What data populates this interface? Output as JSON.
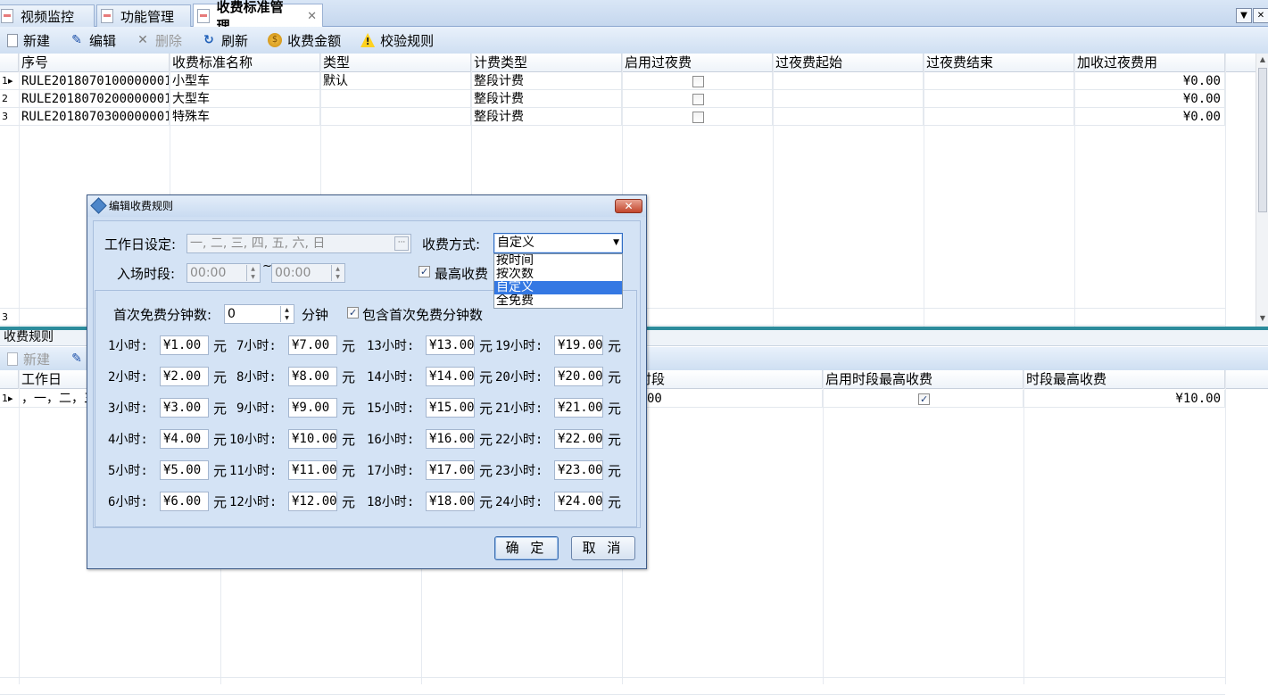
{
  "tabs": [
    {
      "label": "视频监控",
      "active": false
    },
    {
      "label": "功能管理",
      "active": false
    },
    {
      "label": "收费标准管理",
      "active": true
    }
  ],
  "tab_close_glyph": "✕",
  "toolbar1": {
    "new": "新建",
    "edit": "编辑",
    "delete": "删除",
    "refresh": "刷新",
    "fee_amount": "收费金额",
    "validate_rule": "校验规则"
  },
  "grid1": {
    "columns": [
      "序号",
      "收费标准名称",
      "类型",
      "计费类型",
      "启用过夜费",
      "过夜费起始",
      "过夜费结束",
      "加收过夜费用"
    ],
    "rows": [
      {
        "no": "1",
        "id": "RULE2018070100000001",
        "name": "小型车",
        "type": "默认",
        "bill_type": "整段计费",
        "overnight": false,
        "start": "",
        "end": "",
        "fee": "¥0.00"
      },
      {
        "no": "2",
        "id": "RULE2018070200000001",
        "name": "大型车",
        "type": "",
        "bill_type": "整段计费",
        "overnight": false,
        "start": "",
        "end": "",
        "fee": "¥0.00"
      },
      {
        "no": "3",
        "id": "RULE2018070300000001",
        "name": "特殊车",
        "type": "",
        "bill_type": "整段计费",
        "overnight": false,
        "start": "",
        "end": "",
        "fee": "¥0.00"
      }
    ],
    "footer_count": "3"
  },
  "section2": {
    "title": "收费规则",
    "toolbar_new": "新建",
    "columns": [
      "工作日",
      "时段",
      "启用时段最高收费",
      "时段最高收费"
    ],
    "column_partial_visible": "段",
    "row": {
      "no": "1",
      "weekdays": "，一，二，三，",
      "period_tail": "00",
      "max_enabled": true,
      "max_fee": "¥10.00"
    }
  },
  "dialog": {
    "title": "编辑收费规则",
    "close_glyph": "✕",
    "workday_label": "工作日设定:",
    "workday_value": "一, 二, 三, 四, 五, 六, 日",
    "ellipsis": "···",
    "fee_mode_label": "收费方式:",
    "fee_mode_value": "自定义",
    "fee_mode_options": [
      "按时间",
      "按次数",
      "自定义",
      "全免费"
    ],
    "selected_option_index": 2,
    "entry_period_label": "入场时段:",
    "entry_start": "00:00",
    "entry_end": "00:00",
    "tilde": "~",
    "max_fee_label": "最高收费",
    "max_fee_checked": true,
    "free_minutes_label": "首次免费分钟数:",
    "free_minutes_value": "0",
    "minutes_unit": "分钟",
    "include_free_label": "包含首次免费分钟数",
    "include_free_checked": true,
    "hourly_fees": [
      {
        "label": "1小时:",
        "value": "¥1.00"
      },
      {
        "label": "2小时:",
        "value": "¥2.00"
      },
      {
        "label": "3小时:",
        "value": "¥3.00"
      },
      {
        "label": "4小时:",
        "value": "¥4.00"
      },
      {
        "label": "5小时:",
        "value": "¥5.00"
      },
      {
        "label": "6小时:",
        "value": "¥6.00"
      },
      {
        "label": "7小时:",
        "value": "¥7.00"
      },
      {
        "label": "8小时:",
        "value": "¥8.00"
      },
      {
        "label": "9小时:",
        "value": "¥9.00"
      },
      {
        "label": "10小时:",
        "value": "¥10.00"
      },
      {
        "label": "11小时:",
        "value": "¥11.00"
      },
      {
        "label": "12小时:",
        "value": "¥12.00"
      },
      {
        "label": "13小时:",
        "value": "¥13.00"
      },
      {
        "label": "14小时:",
        "value": "¥14.00"
      },
      {
        "label": "15小时:",
        "value": "¥15.00"
      },
      {
        "label": "16小时:",
        "value": "¥16.00"
      },
      {
        "label": "17小时:",
        "value": "¥17.00"
      },
      {
        "label": "18小时:",
        "value": "¥18.00"
      },
      {
        "label": "19小时:",
        "value": "¥19.00"
      },
      {
        "label": "20小时:",
        "value": "¥20.00"
      },
      {
        "label": "21小时:",
        "value": "¥21.00"
      },
      {
        "label": "22小时:",
        "value": "¥22.00"
      },
      {
        "label": "23小时:",
        "value": "¥23.00"
      },
      {
        "label": "24小时:",
        "value": "¥24.00"
      }
    ],
    "yuan_unit": "元",
    "ok_label": "确 定",
    "cancel_label": "取 消"
  },
  "colors": {
    "accent": "#2d8c9c",
    "selection": "#3478e3",
    "dialog_bg": "#d4e3f5"
  }
}
